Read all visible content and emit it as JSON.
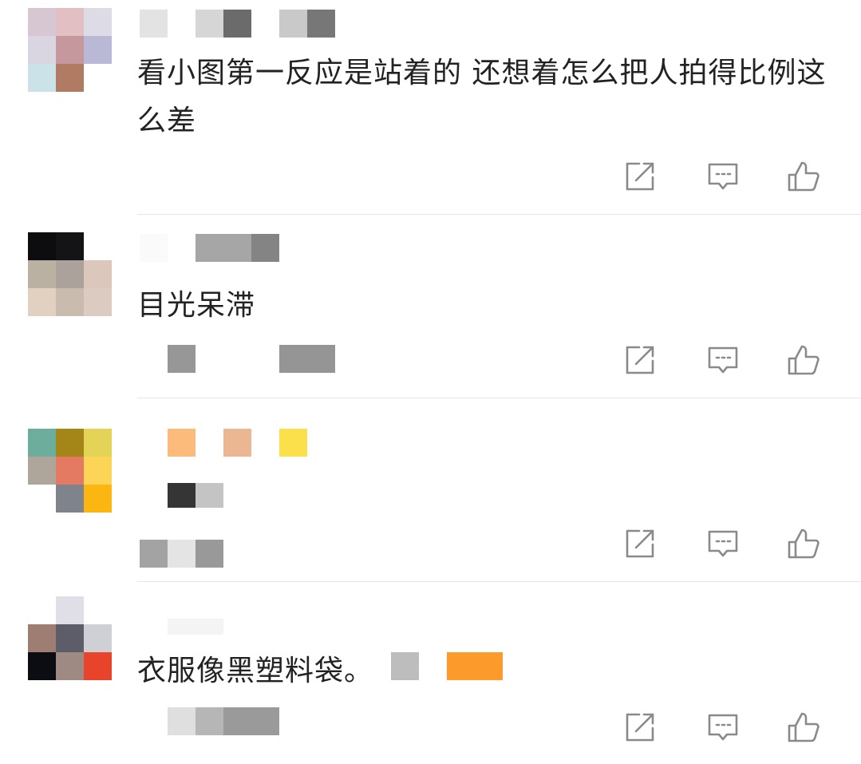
{
  "comments": [
    {
      "text": "看小图第一反应是站着的 还想着怎么把人拍得比例这么差"
    },
    {
      "text": "目光呆滞"
    },
    {
      "text": ""
    },
    {
      "text": "衣服像黑塑料袋。"
    }
  ],
  "icons": {
    "share": "share-icon",
    "reply": "comment-bubble-icon",
    "like": "thumbs-up-icon"
  },
  "colors": {
    "text": "#222222",
    "icon": "#8a8a8a",
    "divider": "#e6e6e6"
  }
}
